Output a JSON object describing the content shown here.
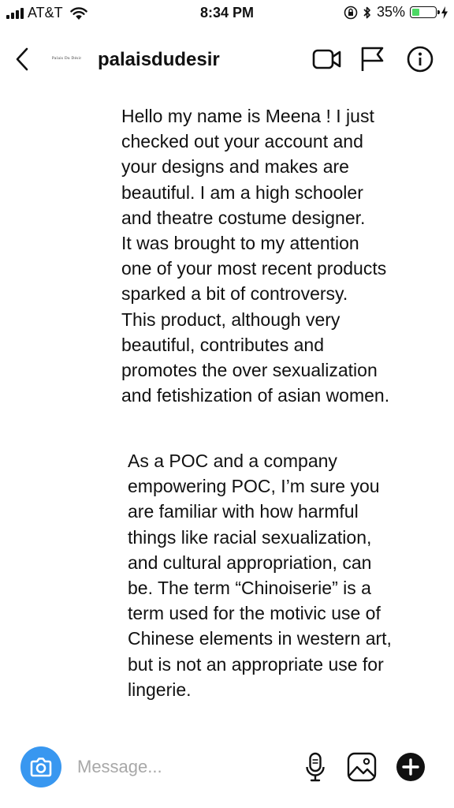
{
  "status_bar": {
    "carrier": "AT&T",
    "time": "8:34 PM",
    "battery_percent": "35%",
    "battery_level": 0.35,
    "icons": [
      "signal-icon",
      "wifi-icon",
      "orientation-lock-icon",
      "bluetooth-icon",
      "battery-icon",
      "charging-icon"
    ]
  },
  "header": {
    "logo_text": "Palais Du Désir",
    "username": "palaisdudesir",
    "icons": [
      "back-icon",
      "video-call-icon",
      "flag-icon",
      "info-icon"
    ]
  },
  "messages": [
    {
      "text": "Hello my name is Meena ! I just\nchecked out your account and\nyour designs and makes are\nbeautiful. I am a high schooler\nand theatre costume designer.\nIt was brought to my attention\none of your most recent products\nsparked a bit of controversy.\nThis product, although very\nbeautiful, contributes and\npromotes the over sexualization\nand fetishization of asian women."
    },
    {
      "text": "As a POC and a company\nempowering POC, I’m sure you\nare familiar with how harmful\nthings like racial sexualization,\nand cultural appropriation, can\nbe. The term “Chinoiserie” is a\nterm used for the motivic use of\nChinese elements in western art,\nbut is not an appropriate use for\nlingerie."
    }
  ],
  "composer": {
    "placeholder": "Message...",
    "icons": [
      "camera-icon",
      "microphone-icon",
      "gallery-icon",
      "plus-icon"
    ]
  },
  "colors": {
    "accent": "#3897f0",
    "battery": "#4cd964",
    "placeholder": "#a8a8a8"
  }
}
